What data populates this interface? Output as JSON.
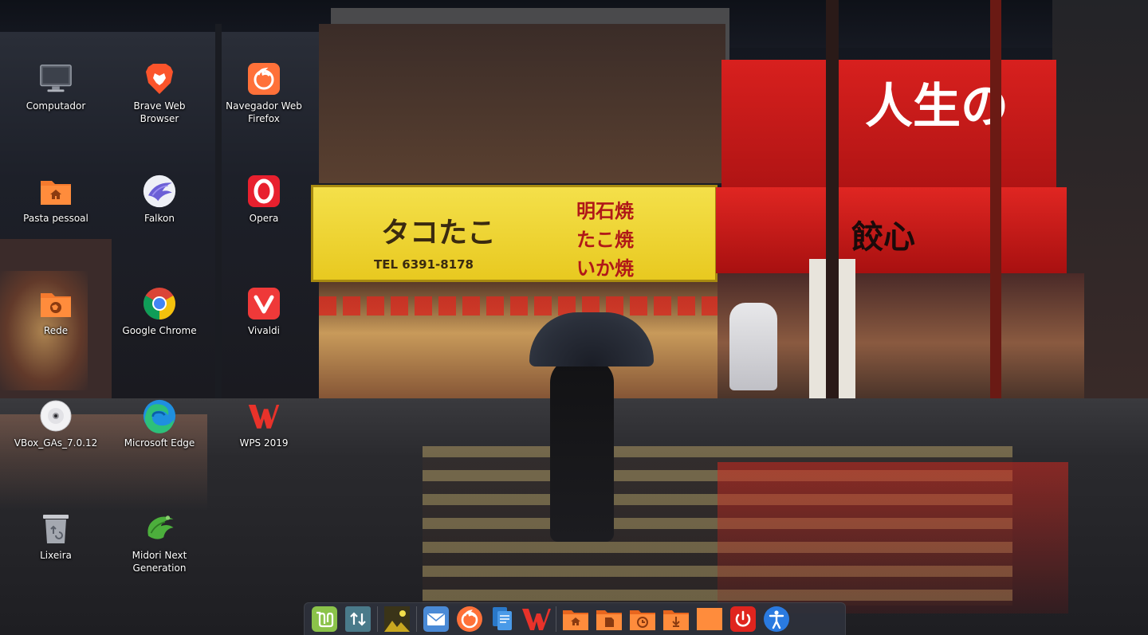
{
  "wallpaper": {
    "yellow_sign_main": "タコたこ",
    "yellow_sign_right": "明石焼\nたこ焼\nいか焼",
    "yellow_sign_phone": "TEL 6391-8178",
    "red_sign_main": "人生の",
    "red_awning_text": "餃心"
  },
  "desktop": {
    "icons": [
      {
        "label": "Computador",
        "icon": "computer-icon"
      },
      {
        "label": "Brave Web\nBrowser",
        "icon": "brave-icon"
      },
      {
        "label": "Navegador Web\nFirefox",
        "icon": "firefox-icon"
      },
      {
        "label": "Pasta pessoal",
        "icon": "home-folder-icon"
      },
      {
        "label": "Falkon",
        "icon": "falkon-icon"
      },
      {
        "label": "Opera",
        "icon": "opera-icon"
      },
      {
        "label": "Rede",
        "icon": "network-folder-icon"
      },
      {
        "label": "Google Chrome",
        "icon": "chrome-icon"
      },
      {
        "label": "Vivaldi",
        "icon": "vivaldi-icon"
      },
      {
        "label": "VBox_GAs_7.0.12",
        "icon": "disc-icon"
      },
      {
        "label": "Microsoft Edge",
        "icon": "edge-icon"
      },
      {
        "label": "WPS 2019",
        "icon": "wps-icon"
      },
      {
        "label": "Lixeira",
        "icon": "trash-icon"
      },
      {
        "label": "Midori Next\nGeneration",
        "icon": "midori-icon"
      }
    ]
  },
  "dock": {
    "items": [
      {
        "icon": "mint-menu-icon"
      },
      {
        "icon": "update-manager-icon"
      },
      {
        "icon": "image-viewer-icon"
      },
      {
        "icon": "mail-icon"
      },
      {
        "icon": "firefox-icon"
      },
      {
        "icon": "file-manager-icon"
      },
      {
        "icon": "wps-icon"
      },
      {
        "icon": "home-folder-icon"
      },
      {
        "icon": "documents-folder-icon"
      },
      {
        "icon": "recent-folder-icon"
      },
      {
        "icon": "downloads-folder-icon"
      },
      {
        "icon": "orange-folder-icon"
      },
      {
        "icon": "power-icon"
      },
      {
        "icon": "accessibility-icon"
      }
    ]
  }
}
